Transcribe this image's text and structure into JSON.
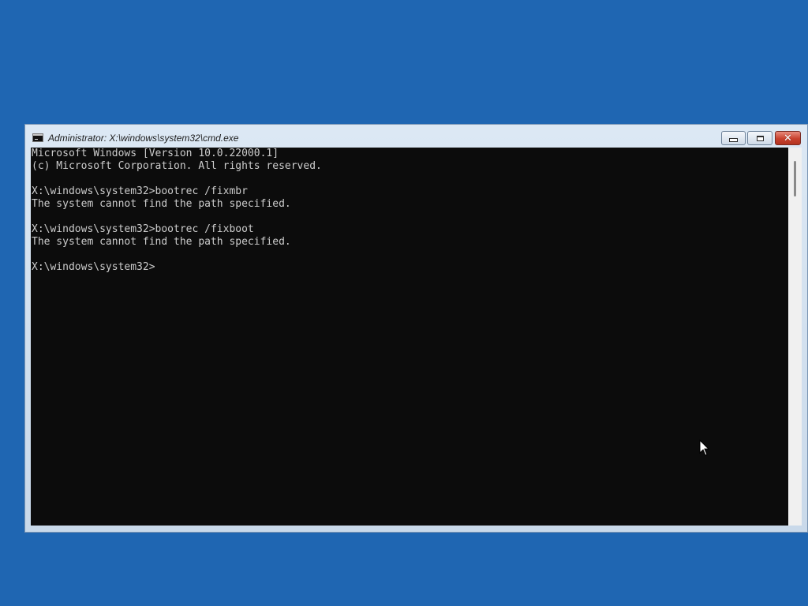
{
  "window": {
    "title": "Administrator: X:\\windows\\system32\\cmd.exe",
    "buttons": {
      "minimize": "minimize-icon",
      "maximize": "restore-icon",
      "close": "close-icon"
    }
  },
  "console": {
    "lines": [
      "Microsoft Windows [Version 10.0.22000.1]",
      "(c) Microsoft Corporation. All rights reserved.",
      "",
      "X:\\windows\\system32>bootrec /fixmbr",
      "The system cannot find the path specified.",
      "",
      "X:\\windows\\system32>bootrec /fixboot",
      "The system cannot find the path specified.",
      "",
      "X:\\windows\\system32>"
    ]
  },
  "colors": {
    "desktop": "#1f66b2",
    "console_bg": "#0c0c0c",
    "console_text": "#cccccc",
    "close_button": "#c8412e"
  }
}
